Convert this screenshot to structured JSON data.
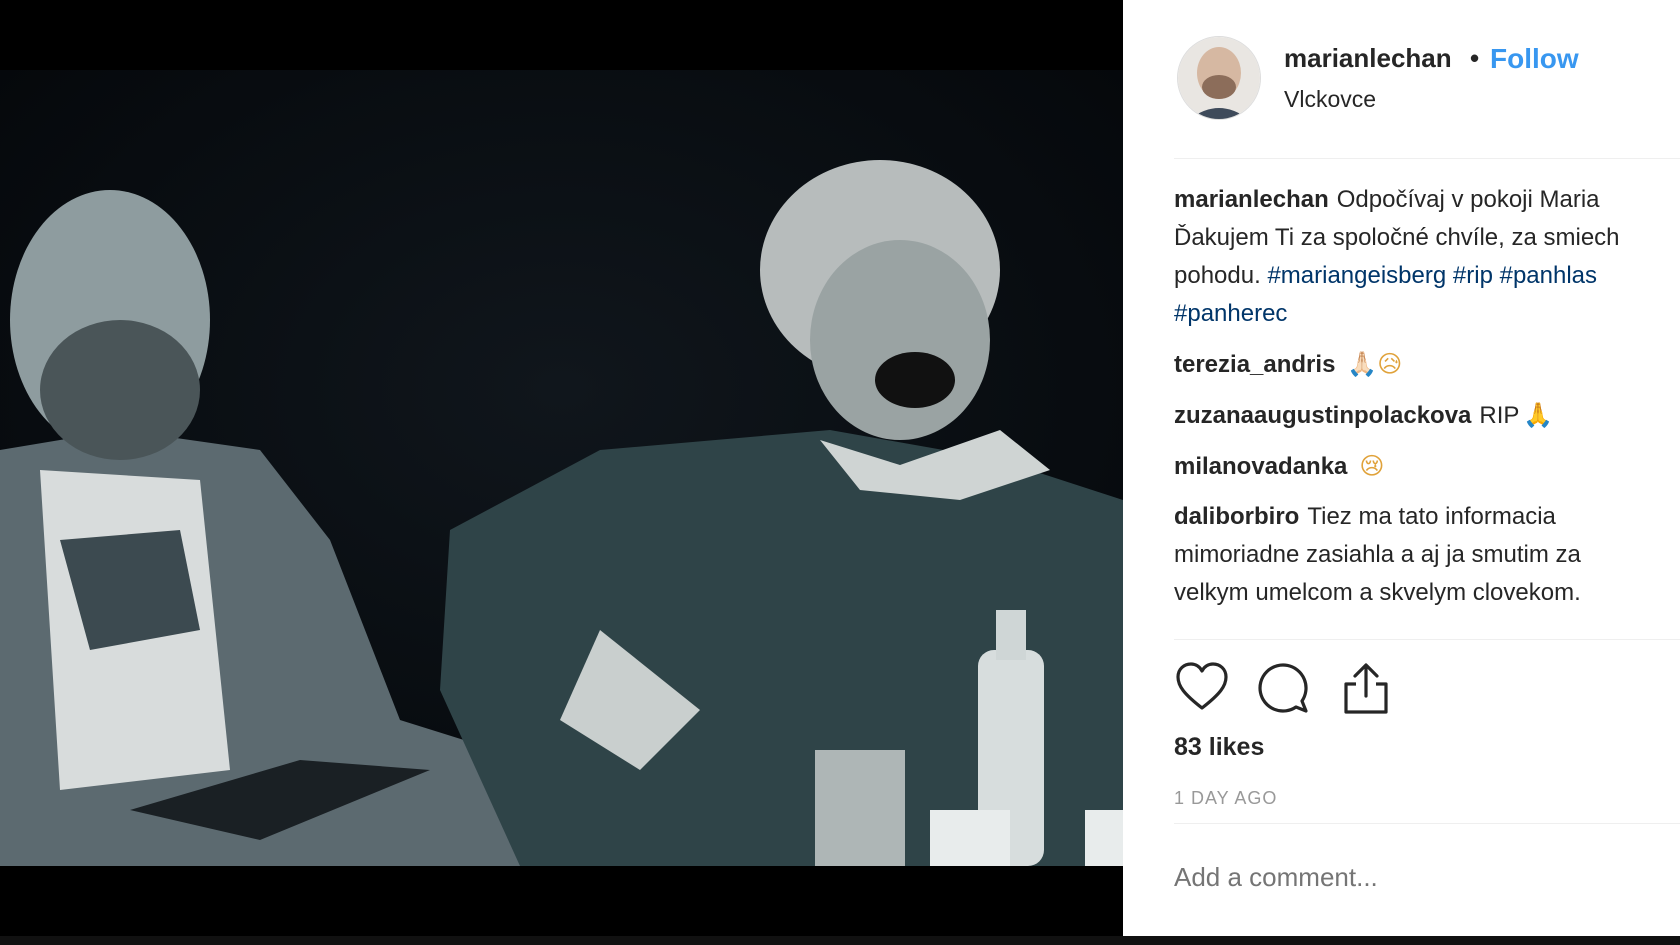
{
  "post": {
    "username": "marianlechan",
    "separator": "•",
    "follow_label": "Follow",
    "location": "Vlckovce",
    "caption": {
      "user": "marianlechan",
      "line1": "Odpočívaj v pokoji Maria",
      "line2": "Ďakujem Ti za spoločné chvíle, za smiech",
      "line3_text": "pohodu.",
      "tags_line3": [
        "#mariangeisberg",
        "#rip",
        "#panhlas"
      ],
      "tags_line4": [
        "#panherec"
      ]
    },
    "comments": [
      {
        "user": "terezia_andris",
        "text": "",
        "emoji": "🙏🏻😥"
      },
      {
        "user": "zuzanaaugustinpolackova",
        "text": "RIP",
        "emoji": "🙏"
      },
      {
        "user": "milanovadanka",
        "text": "",
        "emoji": "😢"
      },
      {
        "user": "daliborbiro",
        "lines": [
          "Tiez ma tato informacia",
          "mimoriadne zasiahla a aj ja smutim za",
          "velkym umelcom a skvelym clovekom."
        ]
      }
    ],
    "likes": "83 likes",
    "time": "1 DAY AGO",
    "add_comment_placeholder": "Add a comment..."
  },
  "icons": [
    "heart-icon",
    "comment-icon",
    "share-icon"
  ],
  "colors": {
    "link": "#3897f0",
    "hashtag": "#003569",
    "text": "#262626",
    "muted": "#999999"
  }
}
